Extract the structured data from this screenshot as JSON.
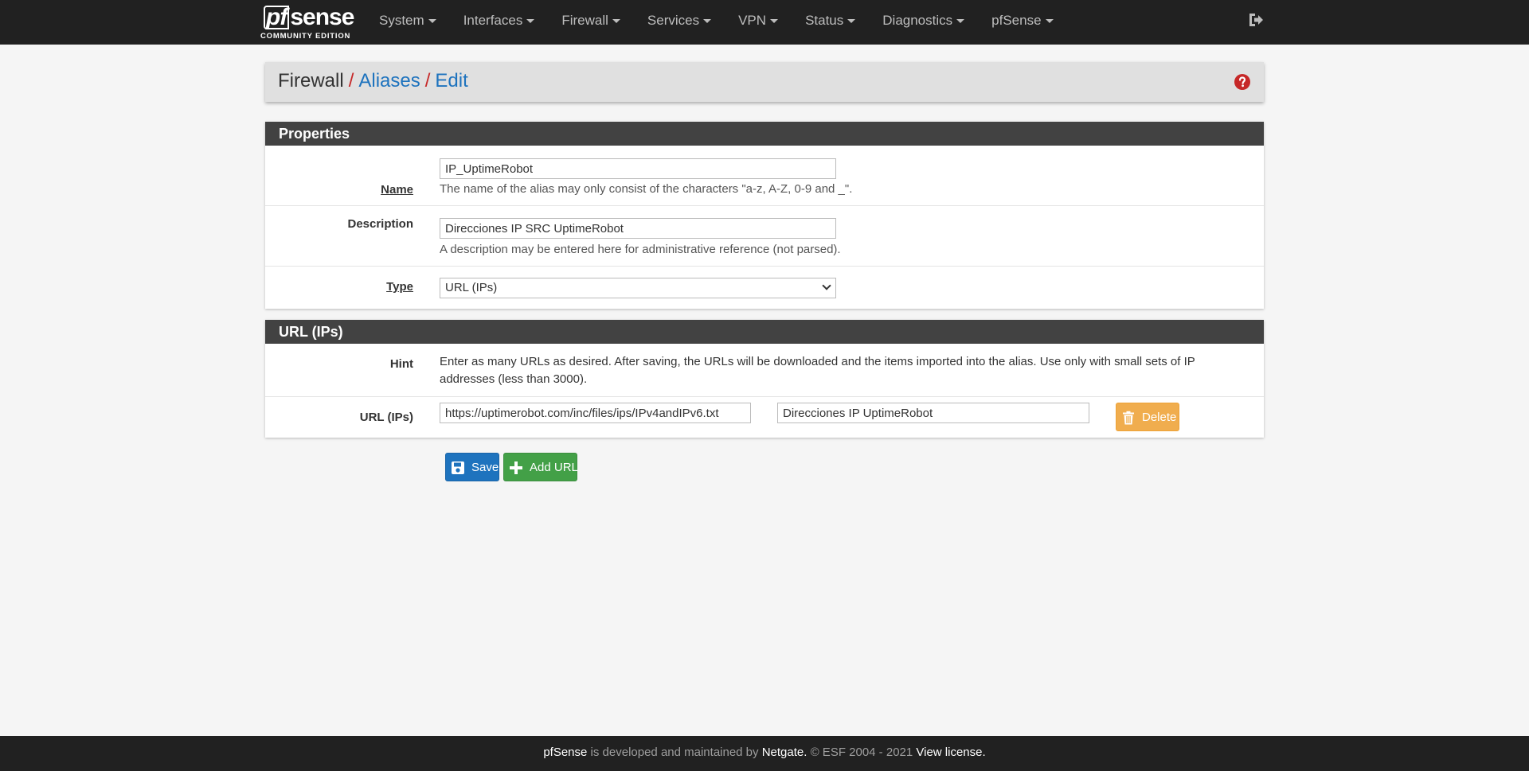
{
  "brand": {
    "name_pf": "pf",
    "name_rest": "sense",
    "edition": "COMMUNITY EDITION"
  },
  "nav": {
    "items": [
      "System",
      "Interfaces",
      "Firewall",
      "Services",
      "VPN",
      "Status",
      "Diagnostics",
      "pfSense"
    ]
  },
  "breadcrumb": {
    "first": "Firewall",
    "second": "Aliases",
    "third": "Edit",
    "separator": "/"
  },
  "properties": {
    "heading": "Properties",
    "name_label": "Name",
    "name_value": "IP_UptimeRobot",
    "name_help": "The name of the alias may only consist of the characters \"a-z, A-Z, 0-9 and _\".",
    "description_label": "Description",
    "description_value": "Direcciones IP SRC UptimeRobot",
    "description_help": "A description may be entered here for administrative reference (not parsed).",
    "type_label": "Type",
    "type_value": "URL (IPs)"
  },
  "urls": {
    "heading": "URL (IPs)",
    "hint_label": "Hint",
    "hint_text": "Enter as many URLs as desired. After saving, the URLs will be downloaded and the items imported into the alias. Use only with small sets of IP addresses (less than 3000).",
    "url_label": "URL (IPs)",
    "url_value": "https://uptimerobot.com/inc/files/ips/IPv4andIPv6.txt",
    "url_description": "Direcciones IP UptimeRobot",
    "delete_label": "Delete"
  },
  "actions": {
    "save_label": "Save",
    "add_url_label": "Add URL"
  },
  "footer": {
    "product": "pfSense",
    "middle": " is developed and maintained by ",
    "company": "Netgate.",
    "copyright": " © ESF 2004 - 2021 ",
    "license": "View license."
  },
  "colors": {
    "navbar": "#212121",
    "link": "#1e73be",
    "separator": "#c62828",
    "panel_heading": "#424242",
    "save": "#1e73be",
    "add": "#43a047",
    "delete": "#f0ad4e"
  }
}
